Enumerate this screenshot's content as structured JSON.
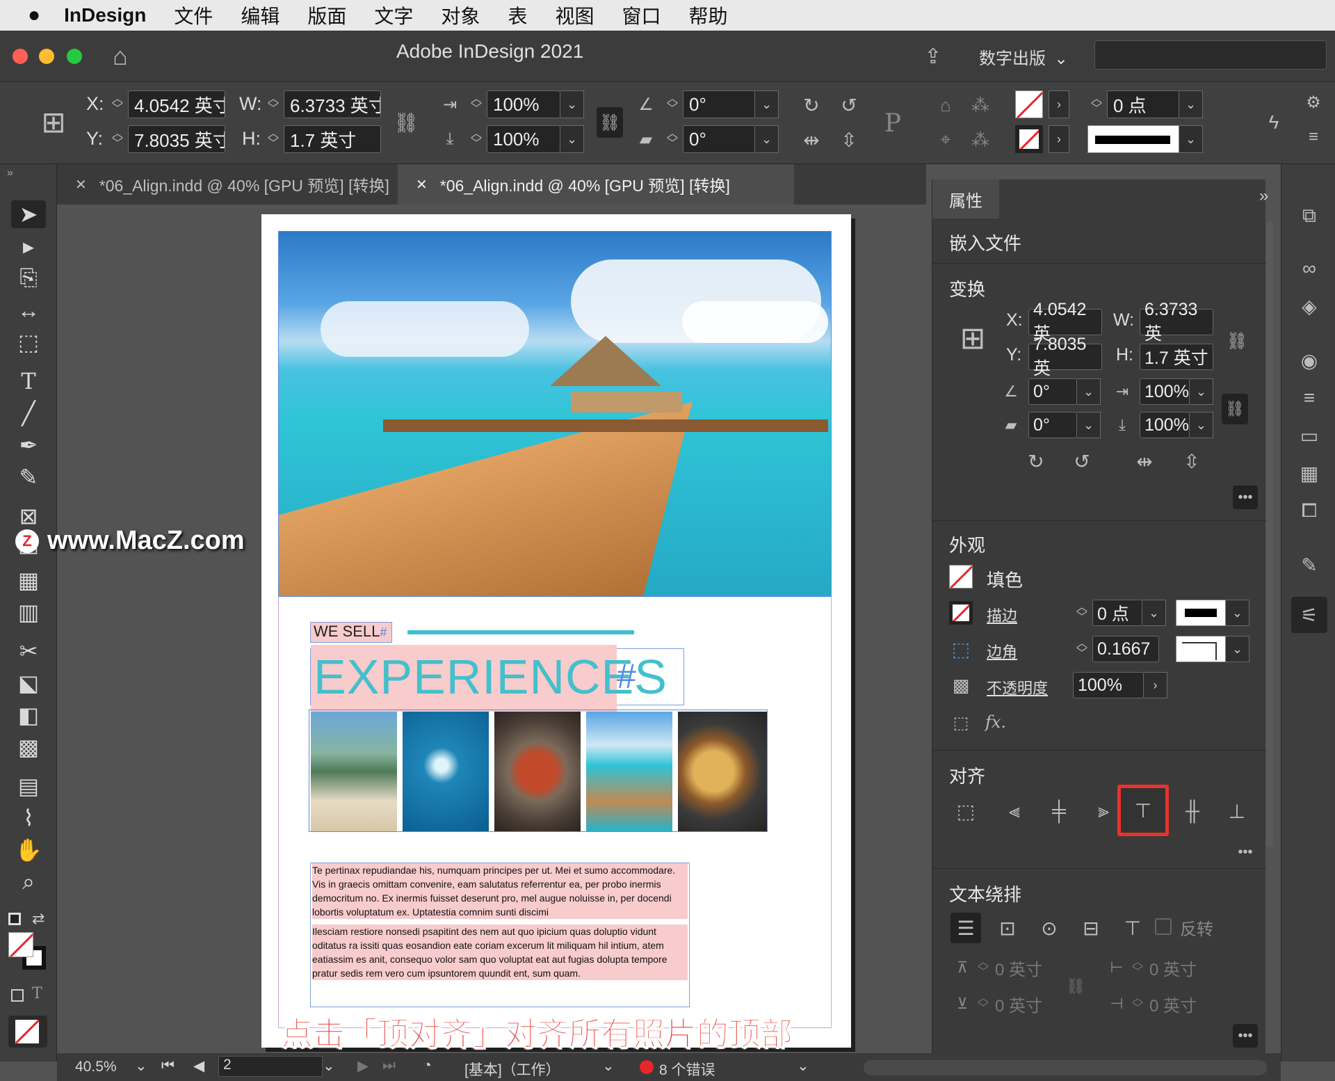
{
  "menubar": {
    "app": "InDesign",
    "items": [
      "文件",
      "编辑",
      "版面",
      "文字",
      "对象",
      "表",
      "视图",
      "窗口",
      "帮助"
    ]
  },
  "title": "Adobe InDesign 2021",
  "workspace": "数字出版",
  "control": {
    "x_label": "X:",
    "x": "4.0542 英寸",
    "y_label": "Y:",
    "y": "7.8035 英寸",
    "w_label": "W:",
    "w": "6.3733 英寸",
    "h_label": "H:",
    "h": "1.7 英寸",
    "scale_x": "100%",
    "scale_y": "100%",
    "angle": "0°",
    "shear": "0°",
    "stroke_weight": "0 点"
  },
  "tabs": [
    {
      "label": "*06_Align.indd @ 40% [GPU 预览] [转换]",
      "active": false
    },
    {
      "label": "*06_Align.indd @ 40% [GPU 预览] [转换]",
      "active": true
    }
  ],
  "document": {
    "heading_small": "WE SELL",
    "heading_large": "EXPERIENCES",
    "para1": "Te pertinax repudiandae his, numquam principes per ut. Mei et sumo accommodare. Vis in graecis omittam convenire, eam salutatus referrentur ea, per probo inermis democritum no. Ex inermis fuisset deserunt pro, mel augue noluisse in, per docendi lobortis voluptatum ex. Uptatestia comnim sunti discimi",
    "para2": "Ilesciam restiore nonsedi psapitint des nem aut quo ipicium quas doluptio vidunt oditatus ra issiti quas eosandion eate coriam excerum lit miliquam hil intium, atem eatiassim es anit, consequo volor sam quo voluptat eat aut fugias dolupta tempore pratur sedis rem vero cum ipsuntorem quundit ent, sum quam."
  },
  "watermark": "www.MacZ.com",
  "caption": "点击「顶对齐」对齐所有照片的顶部",
  "panel": {
    "tab": "属性",
    "object_type": "嵌入文件",
    "transform": "变换",
    "x_label": "X:",
    "x": "4.0542 英",
    "y_label": "Y:",
    "y": "7.8035 英",
    "w_label": "W:",
    "w": "6.3733 英",
    "h_label": "H:",
    "h": "1.7 英寸",
    "rotate": "0°",
    "shear": "0°",
    "scale_x": "100%",
    "scale_y": "100%",
    "appearance": "外观",
    "fill": "填色",
    "stroke": "描边",
    "stroke_weight": "0 点",
    "corner": "边角",
    "corner_value": "0.1667",
    "opacity_label": "不透明度",
    "opacity": "100%",
    "align": "对齐",
    "text_wrap": "文本绕排",
    "invert": "反转",
    "wrap_top": "0 英寸",
    "wrap_bottom": "0 英寸",
    "wrap_left": "0 英寸",
    "wrap_right": "0 英寸",
    "fx": "fx."
  },
  "status": {
    "zoom": "40.5%",
    "page": "2",
    "style": "[基本]（工作）",
    "errors": "8 个错误"
  }
}
